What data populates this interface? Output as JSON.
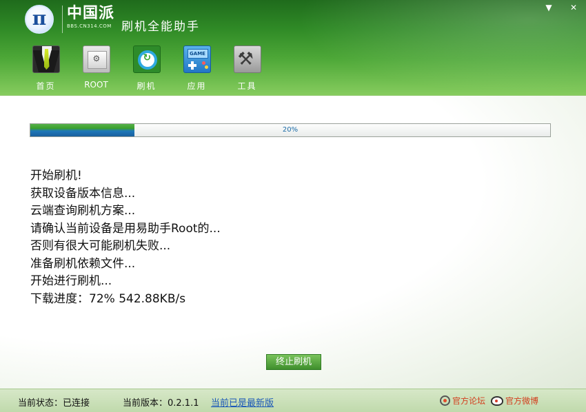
{
  "header": {
    "brand_name": "中国派",
    "brand_url": "BBS.CN314.COM",
    "app_title": "刷机全能助手",
    "logo_glyph": "π"
  },
  "window_controls": {
    "minimize": "▼",
    "close": "✕"
  },
  "toolbar": {
    "items": [
      {
        "label": "首页",
        "icon": "home-suit-icon"
      },
      {
        "label": "ROOT",
        "icon": "root-icon"
      },
      {
        "label": "刷机",
        "icon": "flash-icon"
      },
      {
        "label": "应用",
        "icon": "game-app-icon"
      },
      {
        "label": "工具",
        "icon": "tools-icon"
      }
    ]
  },
  "progress": {
    "value": 0.2,
    "label": "20%"
  },
  "log": {
    "lines": [
      "开始刷机!",
      "获取设备版本信息...",
      "云端查询刷机方案...",
      "请确认当前设备是用易助手Root的...",
      "否则有很大可能刷机失败...",
      "准备刷机依赖文件...",
      "开始进行刷机...",
      "下载进度：72% 542.88KB/s"
    ]
  },
  "stop_button": {
    "label": "终止刷机"
  },
  "statusbar": {
    "connection": "当前状态：已连接",
    "version": "当前版本：0.2.1.1",
    "latest_link": "当前已是最新版",
    "forum_link": "官方论坛",
    "weibo_link": "官方微博"
  },
  "colors": {
    "header_green": "#2f8a26",
    "progress_blue": "#1f78b9",
    "link_blue": "#1a57b8",
    "link_red": "#d2401f"
  }
}
